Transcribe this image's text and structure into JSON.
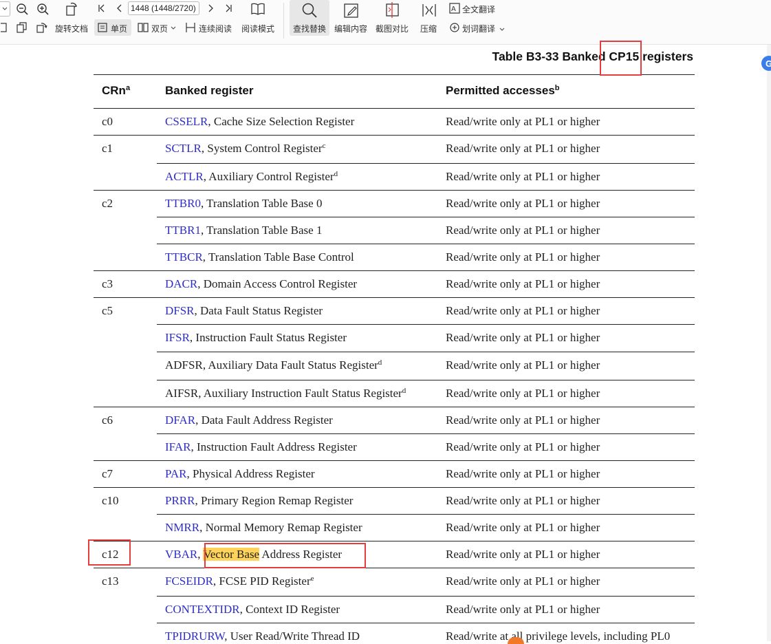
{
  "toolbar": {
    "page_value": "1448 (1448/2720)",
    "rotate_label": "旋转文档",
    "single_page_label": "单页",
    "double_page_label": "双页",
    "continuous_label": "连续阅读",
    "reading_mode_label": "阅读模式",
    "find_replace_label": "查找替换",
    "edit_content_label": "编辑内容",
    "screenshot_compare_label": "截图对比",
    "compress_label": "压缩",
    "full_translate_label": "全文翻译",
    "word_translate_label": "划词翻译",
    "icons": [
      "zoom-out-icon",
      "zoom-in-icon",
      "rotate-page-icon",
      "first-page-icon",
      "prev-page-icon",
      "next-page-icon",
      "last-page-icon",
      "book-icon",
      "search-icon",
      "edit-content-icon",
      "screenshot-compare-icon",
      "compress-icon",
      "full-translate-icon",
      "word-translate-icon"
    ]
  },
  "doc": {
    "caption_prefix": "Table B3-33 Banked ",
    "caption_highlight": "CP15",
    "caption_suffix": " registers",
    "headers": {
      "crn": "CRn",
      "crn_sup": "a",
      "register": "Banked register",
      "access": "Permitted accesses",
      "access_sup": "b"
    },
    "rows": [
      {
        "crn": "c0",
        "reg": "CSSELR",
        "desc": ", Cache Size Selection Register",
        "sup": "",
        "access": "Read/write only at PL1 or higher"
      },
      {
        "crn": "c1",
        "reg": "SCTLR",
        "desc": ", System Control Register",
        "sup": "c",
        "access": "Read/write only at PL1 or higher"
      },
      {
        "crn": "",
        "reg": "ACTLR",
        "desc": ", Auxiliary Control Register",
        "sup": "d",
        "access": "Read/write only at PL1 or higher"
      },
      {
        "crn": "c2",
        "reg": "TTBR0",
        "desc": ", Translation Table Base 0",
        "sup": "",
        "access": "Read/write only at PL1 or higher"
      },
      {
        "crn": "",
        "reg": "TTBR1",
        "desc": ", Translation Table Base 1",
        "sup": "",
        "access": "Read/write only at PL1 or higher"
      },
      {
        "crn": "",
        "reg": "TTBCR",
        "desc": ", Translation Table Base Control",
        "sup": "",
        "access": "Read/write only at PL1 or higher"
      },
      {
        "crn": "c3",
        "reg": "DACR",
        "desc": ", Domain Access Control Register",
        "sup": "",
        "access": "Read/write only at PL1 or higher"
      },
      {
        "crn": "c5",
        "reg": "DFSR",
        "desc": ", Data Fault Status Register",
        "sup": "",
        "access": "Read/write only at PL1 or higher"
      },
      {
        "crn": "",
        "reg": "IFSR",
        "desc": ", Instruction Fault Status Register",
        "sup": "",
        "access": "Read/write only at PL1 or higher"
      },
      {
        "crn": "",
        "reg": "ADFSR",
        "desc": ", Auxiliary Data Fault Status Register",
        "sup": "d",
        "access": "Read/write only at PL1 or higher",
        "plain": true
      },
      {
        "crn": "",
        "reg": "AIFSR",
        "desc": ", Auxiliary Instruction Fault Status Register",
        "sup": "d",
        "access": "Read/write only at PL1 or higher",
        "plain": true
      },
      {
        "crn": "c6",
        "reg": "DFAR",
        "desc": ", Data Fault Address Register",
        "sup": "",
        "access": "Read/write only at PL1 or higher"
      },
      {
        "crn": "",
        "reg": "IFAR",
        "desc": ", Instruction Fault Address Register",
        "sup": "",
        "access": "Read/write only at PL1 or higher"
      },
      {
        "crn": "c7",
        "reg": "PAR",
        "desc": ", Physical Address Register",
        "sup": "",
        "access": "Read/write only at PL1 or higher"
      },
      {
        "crn": "c10",
        "reg": "PRRR",
        "desc": ", Primary Region Remap Register",
        "sup": "",
        "access": "Read/write only at PL1 or higher"
      },
      {
        "crn": "",
        "reg": "NMRR",
        "desc": ", Normal Memory Remap Register",
        "sup": "",
        "access": "Read/write only at PL1 or higher"
      },
      {
        "crn": "c12",
        "reg": "VBAR",
        "desc_pre": ", ",
        "desc_hl": "Vector Base",
        "desc_post": " Address Register",
        "sup": "",
        "access": "Read/write only at PL1 or higher"
      },
      {
        "crn": "c13",
        "reg": "FCSEIDR",
        "desc": ", FCSE PID Register",
        "sup": "e",
        "access": "Read/write only at PL1 or higher"
      },
      {
        "crn": "",
        "reg": "CONTEXTIDR",
        "desc": ", Context ID Register",
        "sup": "",
        "access": "Read/write only at PL1 or higher"
      },
      {
        "crn": "",
        "reg": "TPIDRURW",
        "desc": ", User Read/Write Thread ID",
        "sup": "",
        "access": "Read/write at all privilege levels, including PL0"
      }
    ],
    "colors": {
      "link": "#2e2ec7",
      "highlight": "#ffd35a",
      "annotation": "#e53d3d"
    }
  }
}
